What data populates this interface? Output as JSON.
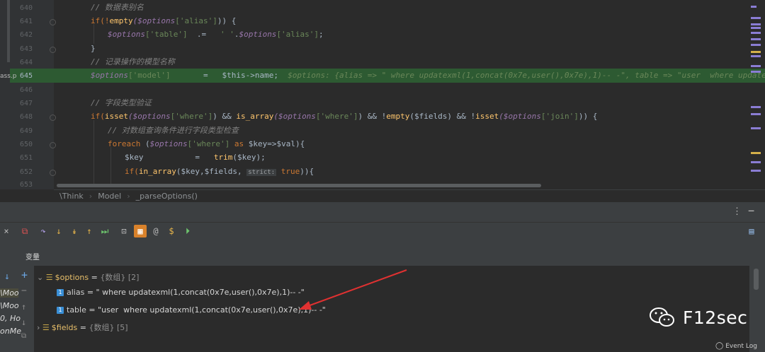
{
  "editor": {
    "file_tab_fragment": "ass.p",
    "line_numbers": [
      "640",
      "641",
      "642",
      "643",
      "644",
      "645",
      "646",
      "647",
      "648",
      "649",
      "650",
      "651",
      "652",
      "653"
    ],
    "lines": {
      "l640": "// 数据表别名",
      "l641a": "if(!",
      "l641b": "empty",
      "l641c": "($options",
      "l641d": "['alias']",
      "l641e": ")) {",
      "l642a": "$options",
      "l642b": "['table']",
      "l642c": "  .=   ",
      "l642d": "' '",
      "l642e": ".",
      "l642f": "$options",
      "l642g": "['alias']",
      "l642h": ";",
      "l643": "}",
      "l644": "// 记录操作的模型名称",
      "l645a": "$options",
      "l645b": "['model']",
      "l645c": "       =   ",
      "l645d": "$this",
      "l645e": "->name;",
      "l645_inline": "$options: {alias => \" where updatexml(1,concat(0x7e,user(),0x7e),1)-- -\", table => \"user  where updatexml(1,concat",
      "l647": "// 字段类型验证",
      "l648a": "if(",
      "l648b": "isset",
      "l648c": "($options",
      "l648d": "['where']",
      "l648e": ") && ",
      "l648f": "is_array",
      "l648g": "($options",
      "l648h": "['where']",
      "l648i": ") && !",
      "l648j": "empty",
      "l648k": "($fields",
      "l648l": ") && !",
      "l648m": "isset",
      "l648n": "($options",
      "l648o": "['join']",
      "l648p": ")) {",
      "l649": "// 对数组查询条件进行字段类型检查",
      "l650a": "foreach",
      "l650b": " (",
      "l650c": "$options",
      "l650d": "['where']",
      "l650e": " as ",
      "l650f": "$key",
      "l650g": "=>",
      "l650h": "$val",
      "l650i": "){",
      "l651a": "$key",
      "l651b": "           =   ",
      "l651c": "trim",
      "l651d": "($key);",
      "l652a": "if(",
      "l652b": "in_array",
      "l652c": "($key,$fields, ",
      "l652d": "strict:",
      "l652e": " true",
      "l652f": ")){"
    }
  },
  "breadcrumb": [
    "\\Think",
    "Model",
    "_parseOptions()"
  ],
  "panel": {
    "vars_title": "变量",
    "tree": {
      "options": {
        "name": "$options",
        "eq": " = ",
        "meta": "{数组} [2]"
      },
      "alias": {
        "badge": "1",
        "name": "alias",
        "eq": " = ",
        "value": "\" where updatexml(1,concat(0x7e,user(),0x7e),1)-- -\""
      },
      "table": {
        "badge": "1",
        "name": "table",
        "eq": " = ",
        "value": "\"user  where updatexml(1,concat(0x7e,user(),0x7e),1)-- -\""
      },
      "fields": {
        "name": "$fields",
        "eq": " = ",
        "meta": "{数组} [5]"
      }
    },
    "frames": [
      "\\Moo",
      "\\Moo",
      "0, Ho",
      "onMe"
    ]
  },
  "watermark": {
    "text": "F12sec"
  },
  "status": {
    "event_log": "Event Log"
  },
  "colors": {
    "highlight": "#2d5a32",
    "arrow": "#e03131",
    "badge": "#3a8fd6"
  }
}
